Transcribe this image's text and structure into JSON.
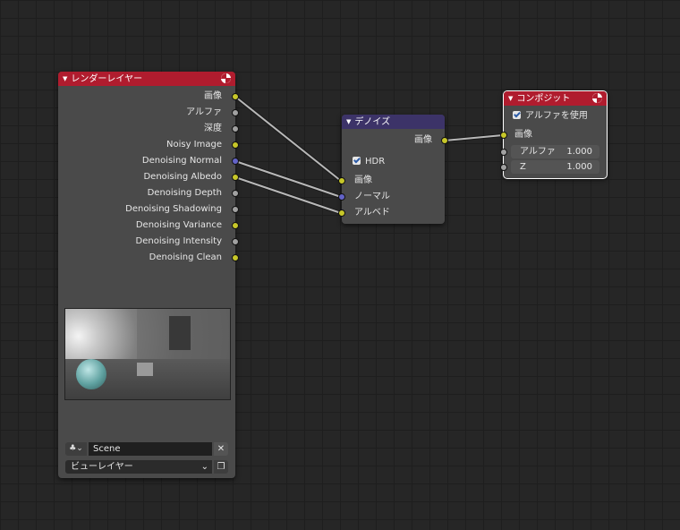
{
  "render_layers": {
    "title": "レンダーレイヤー",
    "outputs": [
      {
        "label": "画像",
        "type": "color"
      },
      {
        "label": "アルファ",
        "type": "value"
      },
      {
        "label": "深度",
        "type": "value"
      },
      {
        "label": "Noisy Image",
        "type": "color"
      },
      {
        "label": "Denoising Normal",
        "type": "vector"
      },
      {
        "label": "Denoising Albedo",
        "type": "color"
      },
      {
        "label": "Denoising Depth",
        "type": "value"
      },
      {
        "label": "Denoising Shadowing",
        "type": "value"
      },
      {
        "label": "Denoising Variance",
        "type": "color"
      },
      {
        "label": "Denoising Intensity",
        "type": "value"
      },
      {
        "label": "Denoising Clean",
        "type": "color"
      }
    ],
    "scene": "Scene",
    "scene_clear": "✕",
    "view_layer": "ビューレイヤー",
    "view_layer_chevron": "⌄"
  },
  "denoise": {
    "title": "デノイズ",
    "output_image": "画像",
    "hdr_label": "HDR",
    "hdr_checked": true,
    "inputs": [
      {
        "label": "画像",
        "type": "color"
      },
      {
        "label": "ノーマル",
        "type": "vector"
      },
      {
        "label": "アルベド",
        "type": "color"
      }
    ]
  },
  "composite": {
    "title": "コンポジット",
    "use_alpha_label": "アルファを使用",
    "use_alpha_checked": true,
    "input_image": "画像",
    "alpha_label": "アルファ",
    "alpha_value": "1.000",
    "z_label": "Z",
    "z_value": "1.000"
  },
  "colors": {
    "canvas": "#262626",
    "input_header": "#b01c2e",
    "filter_header": "#3c3368",
    "output_header": "#b01c2e",
    "node_body": "#4a4a4a",
    "socket_color": "#c7c729",
    "socket_value": "#a1a1a1",
    "socket_vector": "#6363c7",
    "link": "#b8b8b8"
  }
}
